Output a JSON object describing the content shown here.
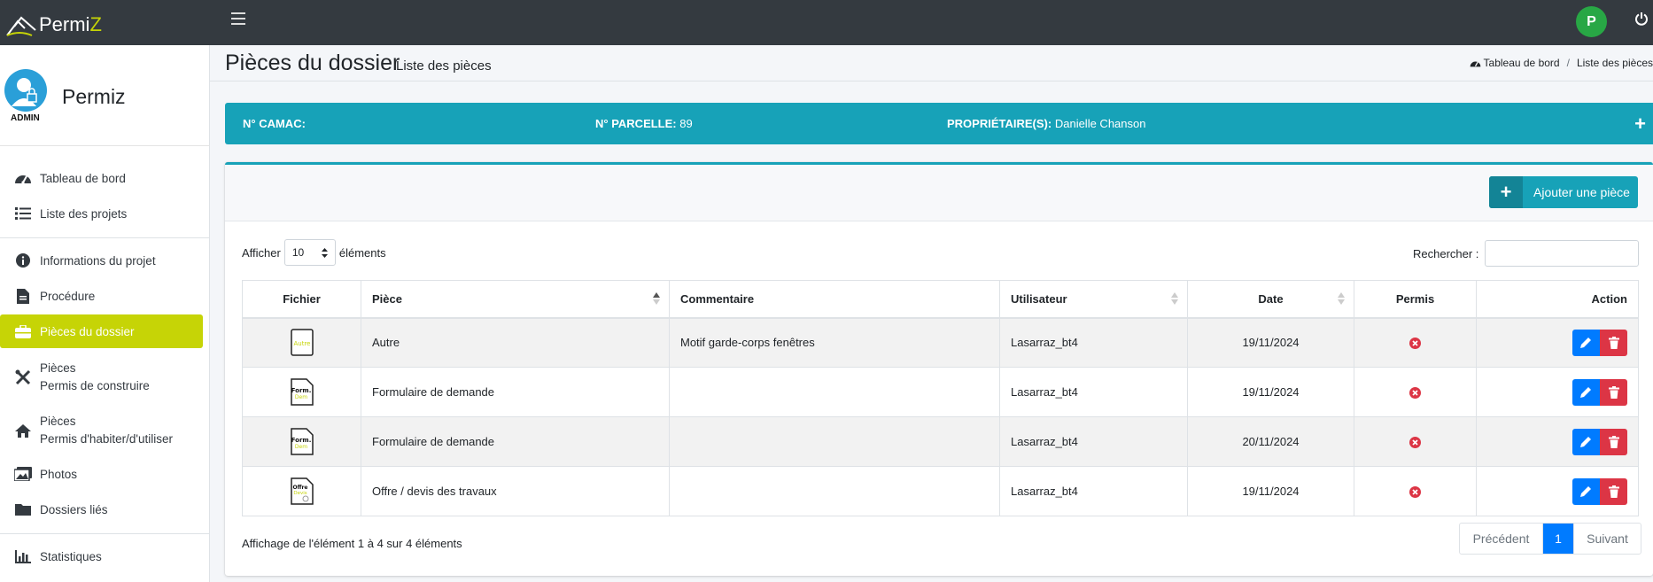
{
  "brand": {
    "name_prefix": "Permi",
    "name_suffix": "Z"
  },
  "header": {
    "user_initial": "P"
  },
  "sidebar": {
    "user_name": "Permiz",
    "role": "ADMIN",
    "items": [
      {
        "label": "Tableau de bord",
        "icon": "tachometer-icon"
      },
      {
        "label": "Liste des projets",
        "icon": "list-icon"
      },
      {
        "label": "Informations du projet",
        "icon": "info-circle-icon"
      },
      {
        "label": "Procédure",
        "icon": "file-icon"
      },
      {
        "label": "Pièces du dossier",
        "icon": "briefcase-icon",
        "active": true
      },
      {
        "label": "Pièces",
        "sublabel": "Permis de construire",
        "icon": "tools-icon"
      },
      {
        "label": "Pièces",
        "sublabel": "Permis d'habiter/d'utiliser",
        "icon": "home-icon"
      },
      {
        "label": "Photos",
        "icon": "images-icon"
      },
      {
        "label": "Dossiers liés",
        "icon": "folder-icon"
      },
      {
        "label": "Statistiques",
        "icon": "chart-bar-icon"
      }
    ]
  },
  "page": {
    "title": "Pièces du dossier",
    "subtitle": "Liste des pièces",
    "breadcrumb": {
      "home": "Tableau de bord",
      "current": "Liste des pièces"
    }
  },
  "info_bar": {
    "camac_label": "N° CAMAC:",
    "camac_value": "",
    "parcelle_label": "N° PARCELLE:",
    "parcelle_value": "89",
    "owner_label": "PROPRIÉTAIRE(S):",
    "owner_value": "Danielle Chanson"
  },
  "toolbar": {
    "add_label": "Ajouter une pièce"
  },
  "table_controls": {
    "show_label": "Afficher",
    "page_length": "10",
    "elements_label": "éléments",
    "search_label": "Rechercher :",
    "search_value": ""
  },
  "table": {
    "headers": [
      "Fichier",
      "Pièce",
      "Commentaire",
      "Utilisateur",
      "Date",
      "Permis",
      "Action"
    ],
    "rows": [
      {
        "file_icon": "Autre",
        "piece": "Autre",
        "comment": "Motif garde-corps fenêtres",
        "user": "Lasarraz_bt4",
        "date": "19/11/2024",
        "permis": false
      },
      {
        "file_icon": "Form. Dem",
        "piece": "Formulaire de demande",
        "comment": "",
        "user": "Lasarraz_bt4",
        "date": "19/11/2024",
        "permis": false
      },
      {
        "file_icon": "Form. Dem",
        "piece": "Formulaire de demande",
        "comment": "",
        "user": "Lasarraz_bt4",
        "date": "20/11/2024",
        "permis": false
      },
      {
        "file_icon": "Offre Devis",
        "piece": "Offre / devis des travaux",
        "comment": "",
        "user": "Lasarraz_bt4",
        "date": "19/11/2024",
        "permis": false
      }
    ]
  },
  "footer": {
    "info": "Affichage de l'élément 1 à 4 sur 4 éléments",
    "prev_label": "Précédent",
    "current_page": "1",
    "next_label": "Suivant"
  },
  "colors": {
    "brand_lime": "#c6d406",
    "info_teal": "#17a2b8",
    "primary_blue": "#007bff",
    "danger_red": "#dc3545",
    "navbar_dark": "#343a40"
  }
}
